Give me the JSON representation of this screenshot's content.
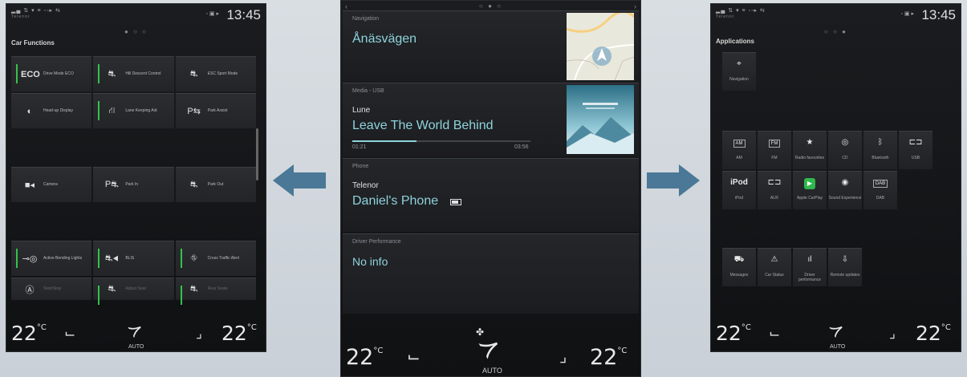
{
  "left": {
    "status": {
      "signal_text": "▂▄ ⇅ ▾ ≡ ◦◦▸ ⇆",
      "operator": "Telenor",
      "icons": "◦ ▣ ▸",
      "time": "13:45"
    },
    "pager": "● ○ ○",
    "title": "Car Functions",
    "tiles": [
      {
        "icon": "ECO",
        "label": "Drive Mode ECO",
        "on": true
      },
      {
        "icon": "⛐",
        "label": "Hill Descent Control",
        "on": true
      },
      {
        "icon": "⛐",
        "label": "ESC Sport Mode",
        "on": false
      },
      {
        "icon": "◐",
        "label": "Head-up Display",
        "on": false
      },
      {
        "icon": "⛙",
        "label": "Lane Keeping Aid",
        "on": true
      },
      {
        "icon": "P⇆",
        "label": "Park Assist",
        "on": false
      },
      {
        "icon": "■◂",
        "label": "Camera",
        "on": false
      },
      {
        "icon": "P⛐",
        "label": "Park In",
        "on": false
      },
      {
        "icon": "⛐",
        "label": "Park Out",
        "on": false
      },
      {
        "icon": "⊸◎",
        "label": "Active Bending Lights",
        "on": true
      },
      {
        "icon": "⛐◂",
        "label": "BLIS",
        "on": true
      },
      {
        "icon": "⛗",
        "label": "Cross Traffic Alert",
        "on": true
      },
      {
        "icon": "Ⓐ",
        "label": "Start/Stop",
        "on": false
      },
      {
        "icon": "⛐",
        "label": "Adjust Seat",
        "on": true
      },
      {
        "icon": "⛐",
        "label": "Rear Seats",
        "on": true
      }
    ],
    "climate": {
      "left_temp": "22",
      "right_temp": "22",
      "unit": "°C",
      "auto": "AUTO"
    }
  },
  "center": {
    "pager": "○ ● ○",
    "nav": {
      "title": "Navigation",
      "destination": "Ånäsvägen"
    },
    "media": {
      "title": "Media - USB",
      "artist": "Lune",
      "track": "Leave The World Behind",
      "elapsed": "01:21",
      "duration": "03:56",
      "progress": 0.36
    },
    "phone": {
      "title": "Phone",
      "operator": "Telenor",
      "device": "Daniel's Phone"
    },
    "driver": {
      "title": "Driver Performance",
      "info": "No info"
    },
    "climate": {
      "left_temp": "22",
      "right_temp": "22",
      "unit": "°C",
      "auto": "AUTO"
    }
  },
  "right": {
    "status": {
      "signal_text": "▂▄ ⇅ ▾ ≡ ◦◦▸ ⇆",
      "operator": "Telenor",
      "icons": "◦ ▣ ▸",
      "time": "13:45"
    },
    "pager": "○ ○ ●",
    "title": "Applications",
    "row1": [
      {
        "icon": "⌖",
        "label": "Navigation"
      }
    ],
    "row2": [
      {
        "icon": "AM",
        "label": "AM"
      },
      {
        "icon": "FM",
        "label": "FM"
      },
      {
        "icon": "★",
        "label": "Radio favourites"
      },
      {
        "icon": "◎",
        "label": "CD"
      },
      {
        "icon": "ᛒ",
        "label": "Bluetooth"
      },
      {
        "icon": "⊏⊐",
        "label": "USB"
      }
    ],
    "row3": [
      {
        "icon": "iPod",
        "label": "iPod"
      },
      {
        "icon": "⊏⊐",
        "label": "AUX"
      },
      {
        "icon": "▶",
        "label": "Apple CarPlay"
      },
      {
        "icon": "◉",
        "label": "Sound Experience"
      },
      {
        "icon": "DAB",
        "label": "DAB"
      }
    ],
    "row4": [
      {
        "icon": "⛟",
        "label": "Messages"
      },
      {
        "icon": "⚠",
        "label": "Car Status"
      },
      {
        "icon": "ıl",
        "label": "Driver performance"
      },
      {
        "icon": "⇩",
        "label": "Remote updates"
      }
    ],
    "climate": {
      "left_temp": "22",
      "right_temp": "22",
      "unit": "°C",
      "auto": "AUTO"
    }
  },
  "colors": {
    "arrow": "#4a7896",
    "accent": "#8ed3dc",
    "active": "#35c24a"
  }
}
